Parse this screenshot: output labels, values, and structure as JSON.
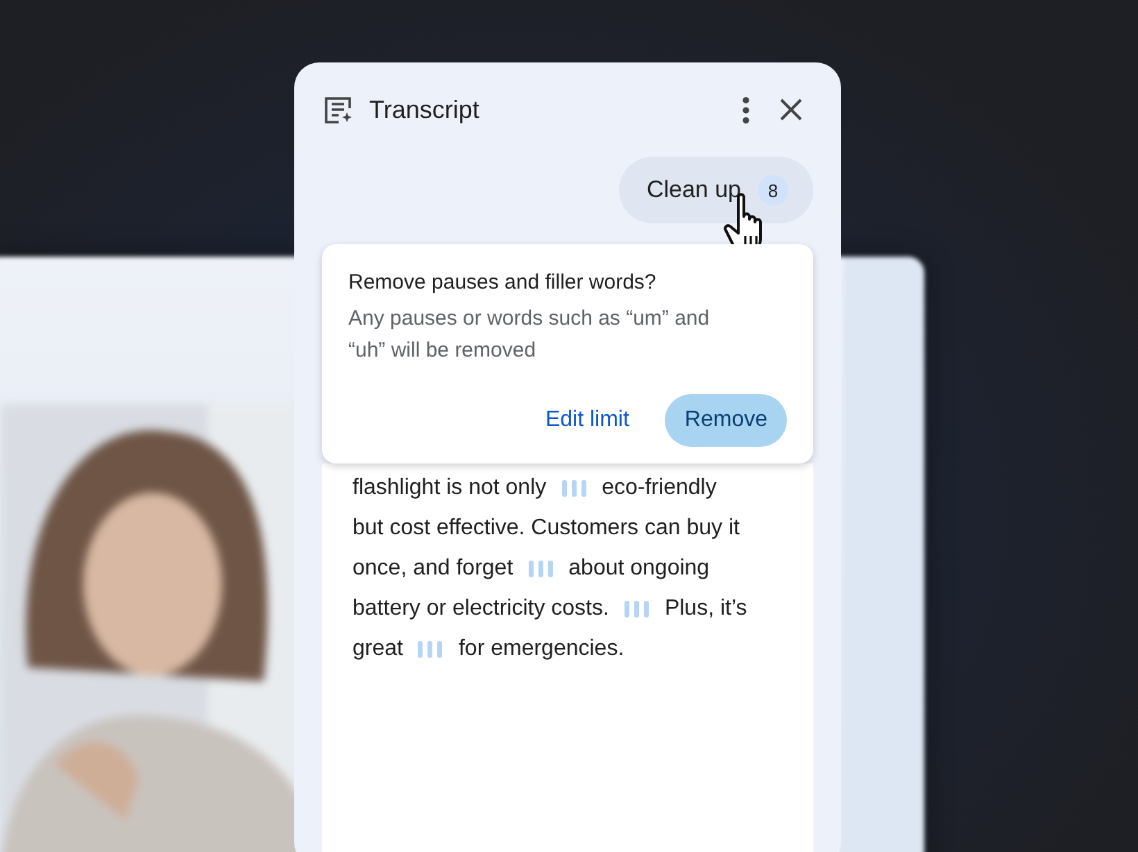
{
  "panel": {
    "title": "Transcript",
    "clean_up": {
      "label": "Clean up",
      "count": "8"
    }
  },
  "dialog": {
    "title": "Remove pauses and filler words?",
    "message": "Any pauses or words such as “um” and “uh” will be removed",
    "buttons": [
      {
        "label": "Edit limit",
        "kind": "text"
      },
      {
        "label": "Remove",
        "kind": "filled"
      }
    ]
  },
  "transcript": {
    "lines": [
      [
        {
          "kind": "text",
          "text": "flashlight is not only"
        },
        {
          "kind": "pause"
        },
        {
          "kind": "text",
          "text": "eco-friendly"
        }
      ],
      [
        {
          "kind": "text",
          "text": "but cost effective. Customers can buy it"
        }
      ],
      [
        {
          "kind": "text",
          "text": "once, and forget"
        },
        {
          "kind": "pause"
        },
        {
          "kind": "text",
          "text": "about ongoing"
        }
      ],
      [
        {
          "kind": "text",
          "text": "battery or electricity costs."
        },
        {
          "kind": "pause"
        },
        {
          "kind": "text",
          "text": "Plus, it’s"
        }
      ],
      [
        {
          "kind": "text",
          "text": "great"
        },
        {
          "kind": "pause"
        },
        {
          "kind": "text",
          "text": "for emergencies."
        }
      ]
    ]
  }
}
